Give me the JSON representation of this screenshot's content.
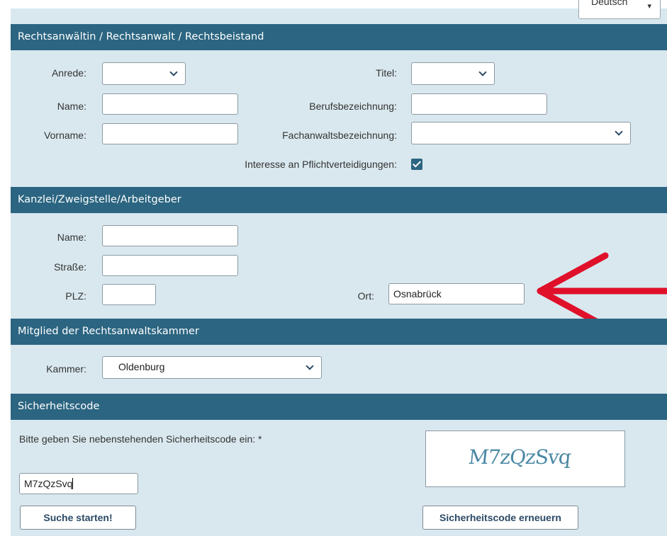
{
  "language_select": {
    "value": "Deutsch"
  },
  "sections": {
    "lawyer": "Rechtsanwältin / Rechtsanwalt / Rechtsbeistand",
    "office": "Kanzlei/Zweigstelle/Arbeitgeber",
    "chamber": "Mitglied der Rechtsanwaltskammer",
    "security": "Sicherheitscode"
  },
  "lawyer": {
    "anrede_label": "Anrede:",
    "anrede_value": "",
    "titel_label": "Titel:",
    "titel_value": "",
    "name_label": "Name:",
    "name_value": "",
    "berufsbezeichnung_label": "Berufsbezeichnung:",
    "berufsbezeichnung_value": "",
    "vorname_label": "Vorname:",
    "vorname_value": "",
    "fachanwalt_label": "Fachanwaltsbezeichnung:",
    "fachanwalt_value": "",
    "pflicht_label": "Interesse an Pflichtverteidigungen:",
    "pflicht_checked": true
  },
  "office": {
    "name_label": "Name:",
    "name_value": "",
    "strasse_label": "Straße:",
    "strasse_value": "",
    "plz_label": "PLZ:",
    "plz_value": "",
    "ort_label": "Ort:",
    "ort_value": "Osnabrück"
  },
  "chamber": {
    "kammer_label": "Kammer:",
    "kammer_value": "Oldenburg"
  },
  "security": {
    "prompt": "Bitte geben Sie nebenstehenden Sicherheitscode ein: *",
    "input_value": "M7zQzSvq",
    "captcha_text": "M7zQzSvq"
  },
  "buttons": {
    "search": "Suche starten!",
    "renew": "Sicherheitscode erneuern"
  },
  "colors": {
    "section_bar": "#2b6581",
    "panel_bg": "#d9e8ef",
    "annotation_arrow": "#e0102a"
  },
  "annotation": {
    "icon": "red-arrow-left-icon"
  }
}
